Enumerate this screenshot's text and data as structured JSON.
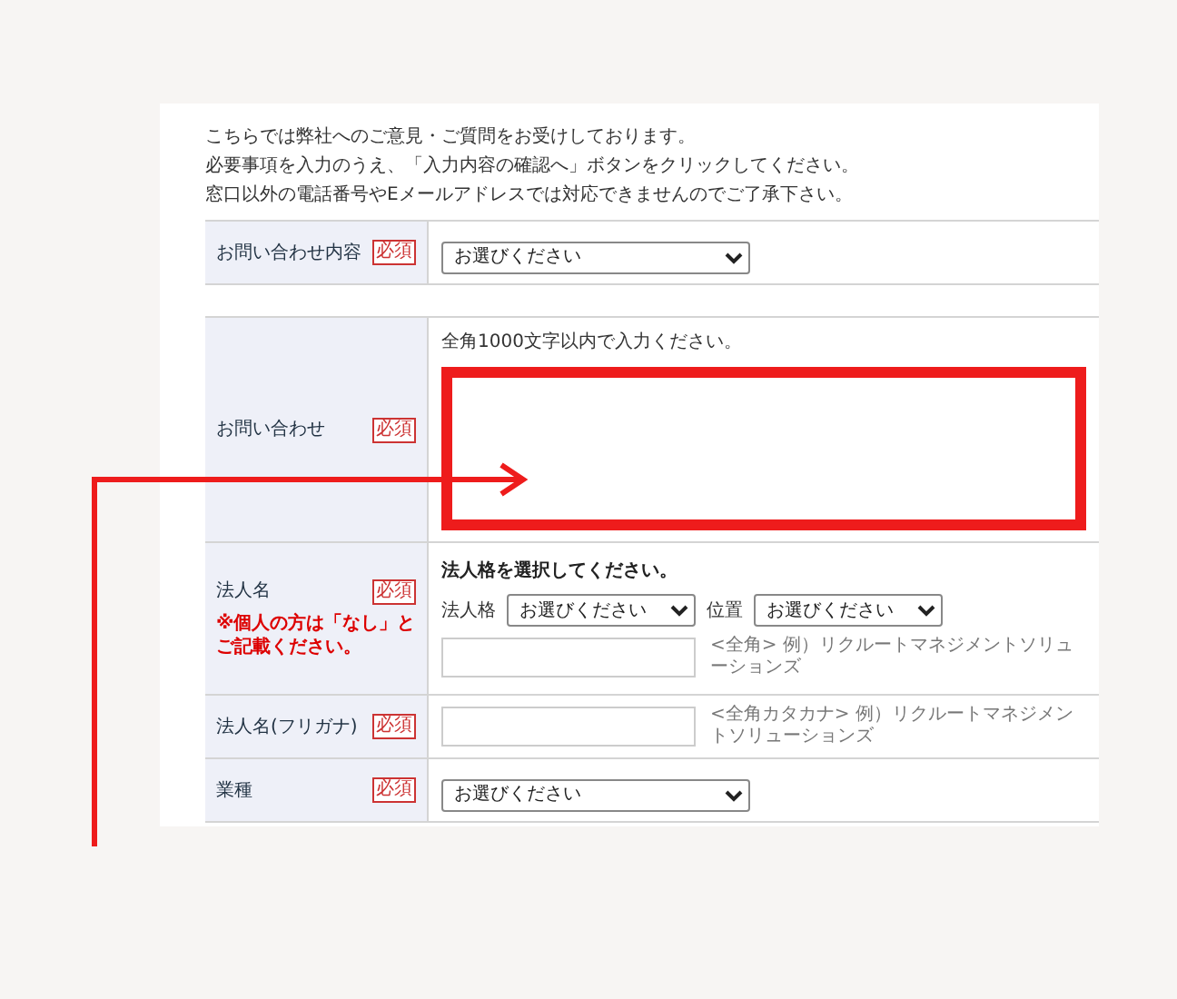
{
  "intro": [
    "こちらでは弊社へのご意見・ご質問をお受けしております。",
    "必要事項を入力のうえ、「入力内容の確認へ」ボタンをクリックしてください。",
    "窓口以外の電話番号やEメールアドレスでは対応できませんのでご了承下さい。"
  ],
  "rows": [
    {
      "kind": "select",
      "label": "お問い合わせ内容",
      "badge": "必須",
      "value": "お選びください"
    },
    {
      "kind": "textarea",
      "label": "お問い合わせ",
      "badge": "必須",
      "hint": "全角1000文字以内で入力ください。",
      "highlighted": true
    },
    {
      "kind": "corporate",
      "label": "法人名",
      "badge": "必須",
      "note": "※個人の方は「なし」とご記載ください。",
      "instruction": "法人格を選択してください。",
      "selects": [
        {
          "label": "法人格",
          "value": "お選びください"
        },
        {
          "label": "位置",
          "value": "お選びください"
        }
      ],
      "example": "<全角> 例）リクルートマネジメントソリューションズ"
    },
    {
      "kind": "input",
      "label": "法人名(フリガナ)",
      "badge": "必須",
      "example": "<全角カタカナ> 例）リクルートマネジメントソリューションズ"
    },
    {
      "kind": "select",
      "label": "業種",
      "badge": "必須",
      "value": "お選びください"
    }
  ]
}
